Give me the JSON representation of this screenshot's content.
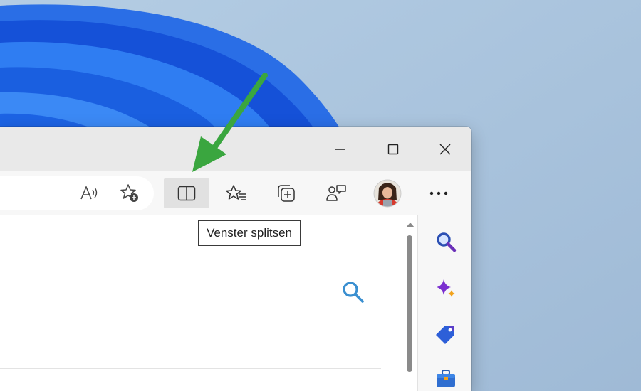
{
  "window": {
    "caption_buttons": [
      {
        "name": "minimize",
        "icon": "minimize-icon"
      },
      {
        "name": "maximize",
        "icon": "maximize-icon"
      },
      {
        "name": "close",
        "icon": "close-icon"
      }
    ]
  },
  "toolbar": {
    "address_icons": [
      "read-aloud-icon",
      "add-favorite-icon"
    ],
    "buttons": [
      {
        "name": "split-window",
        "icon": "split-screen-icon",
        "active": true
      },
      {
        "name": "favorites",
        "icon": "favorites-icon"
      },
      {
        "name": "collections",
        "icon": "collections-icon"
      },
      {
        "name": "feedback",
        "icon": "feedback-icon"
      },
      {
        "name": "profile",
        "icon": "avatar"
      },
      {
        "name": "settings-and-more",
        "icon": "more-icon"
      }
    ]
  },
  "tooltip": {
    "text": "Venster splitsen"
  },
  "sidebar": {
    "items": [
      {
        "name": "search",
        "icon": "search-icon"
      },
      {
        "name": "copilot",
        "icon": "sparkle-icon"
      },
      {
        "name": "shopping",
        "icon": "tag-icon"
      },
      {
        "name": "tools",
        "icon": "toolbox-icon"
      }
    ]
  },
  "colors": {
    "accent_arrow": "#3aa63f",
    "desktop_bg": "#a9c3dc",
    "bloom": "#1a5fe0",
    "sidebar_search": "#2b4fb3",
    "content_search": "#3a8fd0"
  }
}
